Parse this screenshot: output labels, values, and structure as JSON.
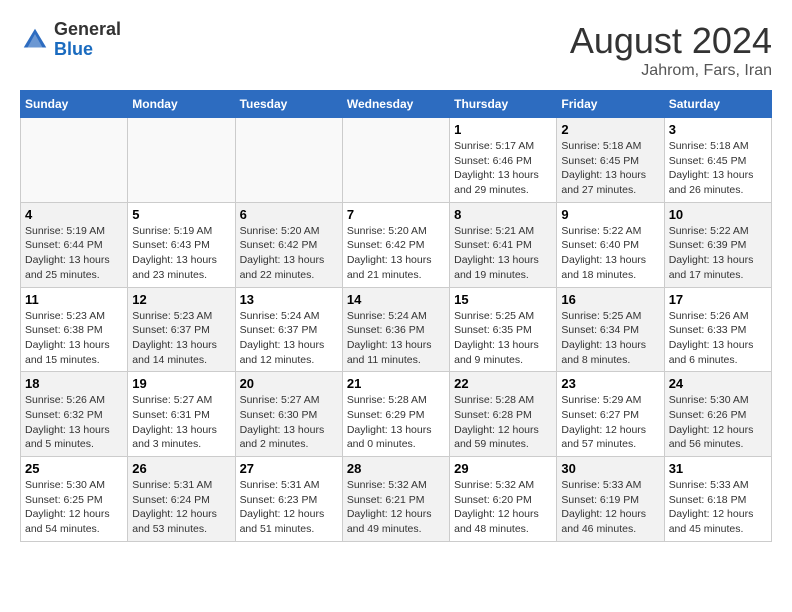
{
  "header": {
    "logo_general": "General",
    "logo_blue": "Blue",
    "month_year": "August 2024",
    "location": "Jahrom, Fars, Iran"
  },
  "weekdays": [
    "Sunday",
    "Monday",
    "Tuesday",
    "Wednesday",
    "Thursday",
    "Friday",
    "Saturday"
  ],
  "weeks": [
    [
      {
        "day": "",
        "info": "",
        "shaded": false,
        "empty": true
      },
      {
        "day": "",
        "info": "",
        "shaded": false,
        "empty": true
      },
      {
        "day": "",
        "info": "",
        "shaded": false,
        "empty": true
      },
      {
        "day": "",
        "info": "",
        "shaded": false,
        "empty": true
      },
      {
        "day": "1",
        "info": "Sunrise: 5:17 AM\nSunset: 6:46 PM\nDaylight: 13 hours\nand 29 minutes.",
        "shaded": false,
        "empty": false
      },
      {
        "day": "2",
        "info": "Sunrise: 5:18 AM\nSunset: 6:45 PM\nDaylight: 13 hours\nand 27 minutes.",
        "shaded": true,
        "empty": false
      },
      {
        "day": "3",
        "info": "Sunrise: 5:18 AM\nSunset: 6:45 PM\nDaylight: 13 hours\nand 26 minutes.",
        "shaded": false,
        "empty": false
      }
    ],
    [
      {
        "day": "4",
        "info": "Sunrise: 5:19 AM\nSunset: 6:44 PM\nDaylight: 13 hours\nand 25 minutes.",
        "shaded": true,
        "empty": false
      },
      {
        "day": "5",
        "info": "Sunrise: 5:19 AM\nSunset: 6:43 PM\nDaylight: 13 hours\nand 23 minutes.",
        "shaded": false,
        "empty": false
      },
      {
        "day": "6",
        "info": "Sunrise: 5:20 AM\nSunset: 6:42 PM\nDaylight: 13 hours\nand 22 minutes.",
        "shaded": true,
        "empty": false
      },
      {
        "day": "7",
        "info": "Sunrise: 5:20 AM\nSunset: 6:42 PM\nDaylight: 13 hours\nand 21 minutes.",
        "shaded": false,
        "empty": false
      },
      {
        "day": "8",
        "info": "Sunrise: 5:21 AM\nSunset: 6:41 PM\nDaylight: 13 hours\nand 19 minutes.",
        "shaded": true,
        "empty": false
      },
      {
        "day": "9",
        "info": "Sunrise: 5:22 AM\nSunset: 6:40 PM\nDaylight: 13 hours\nand 18 minutes.",
        "shaded": false,
        "empty": false
      },
      {
        "day": "10",
        "info": "Sunrise: 5:22 AM\nSunset: 6:39 PM\nDaylight: 13 hours\nand 17 minutes.",
        "shaded": true,
        "empty": false
      }
    ],
    [
      {
        "day": "11",
        "info": "Sunrise: 5:23 AM\nSunset: 6:38 PM\nDaylight: 13 hours\nand 15 minutes.",
        "shaded": false,
        "empty": false
      },
      {
        "day": "12",
        "info": "Sunrise: 5:23 AM\nSunset: 6:37 PM\nDaylight: 13 hours\nand 14 minutes.",
        "shaded": true,
        "empty": false
      },
      {
        "day": "13",
        "info": "Sunrise: 5:24 AM\nSunset: 6:37 PM\nDaylight: 13 hours\nand 12 minutes.",
        "shaded": false,
        "empty": false
      },
      {
        "day": "14",
        "info": "Sunrise: 5:24 AM\nSunset: 6:36 PM\nDaylight: 13 hours\nand 11 minutes.",
        "shaded": true,
        "empty": false
      },
      {
        "day": "15",
        "info": "Sunrise: 5:25 AM\nSunset: 6:35 PM\nDaylight: 13 hours\nand 9 minutes.",
        "shaded": false,
        "empty": false
      },
      {
        "day": "16",
        "info": "Sunrise: 5:25 AM\nSunset: 6:34 PM\nDaylight: 13 hours\nand 8 minutes.",
        "shaded": true,
        "empty": false
      },
      {
        "day": "17",
        "info": "Sunrise: 5:26 AM\nSunset: 6:33 PM\nDaylight: 13 hours\nand 6 minutes.",
        "shaded": false,
        "empty": false
      }
    ],
    [
      {
        "day": "18",
        "info": "Sunrise: 5:26 AM\nSunset: 6:32 PM\nDaylight: 13 hours\nand 5 minutes.",
        "shaded": true,
        "empty": false
      },
      {
        "day": "19",
        "info": "Sunrise: 5:27 AM\nSunset: 6:31 PM\nDaylight: 13 hours\nand 3 minutes.",
        "shaded": false,
        "empty": false
      },
      {
        "day": "20",
        "info": "Sunrise: 5:27 AM\nSunset: 6:30 PM\nDaylight: 13 hours\nand 2 minutes.",
        "shaded": true,
        "empty": false
      },
      {
        "day": "21",
        "info": "Sunrise: 5:28 AM\nSunset: 6:29 PM\nDaylight: 13 hours\nand 0 minutes.",
        "shaded": false,
        "empty": false
      },
      {
        "day": "22",
        "info": "Sunrise: 5:28 AM\nSunset: 6:28 PM\nDaylight: 12 hours\nand 59 minutes.",
        "shaded": true,
        "empty": false
      },
      {
        "day": "23",
        "info": "Sunrise: 5:29 AM\nSunset: 6:27 PM\nDaylight: 12 hours\nand 57 minutes.",
        "shaded": false,
        "empty": false
      },
      {
        "day": "24",
        "info": "Sunrise: 5:30 AM\nSunset: 6:26 PM\nDaylight: 12 hours\nand 56 minutes.",
        "shaded": true,
        "empty": false
      }
    ],
    [
      {
        "day": "25",
        "info": "Sunrise: 5:30 AM\nSunset: 6:25 PM\nDaylight: 12 hours\nand 54 minutes.",
        "shaded": false,
        "empty": false
      },
      {
        "day": "26",
        "info": "Sunrise: 5:31 AM\nSunset: 6:24 PM\nDaylight: 12 hours\nand 53 minutes.",
        "shaded": true,
        "empty": false
      },
      {
        "day": "27",
        "info": "Sunrise: 5:31 AM\nSunset: 6:23 PM\nDaylight: 12 hours\nand 51 minutes.",
        "shaded": false,
        "empty": false
      },
      {
        "day": "28",
        "info": "Sunrise: 5:32 AM\nSunset: 6:21 PM\nDaylight: 12 hours\nand 49 minutes.",
        "shaded": true,
        "empty": false
      },
      {
        "day": "29",
        "info": "Sunrise: 5:32 AM\nSunset: 6:20 PM\nDaylight: 12 hours\nand 48 minutes.",
        "shaded": false,
        "empty": false
      },
      {
        "day": "30",
        "info": "Sunrise: 5:33 AM\nSunset: 6:19 PM\nDaylight: 12 hours\nand 46 minutes.",
        "shaded": true,
        "empty": false
      },
      {
        "day": "31",
        "info": "Sunrise: 5:33 AM\nSunset: 6:18 PM\nDaylight: 12 hours\nand 45 minutes.",
        "shaded": false,
        "empty": false
      }
    ]
  ]
}
